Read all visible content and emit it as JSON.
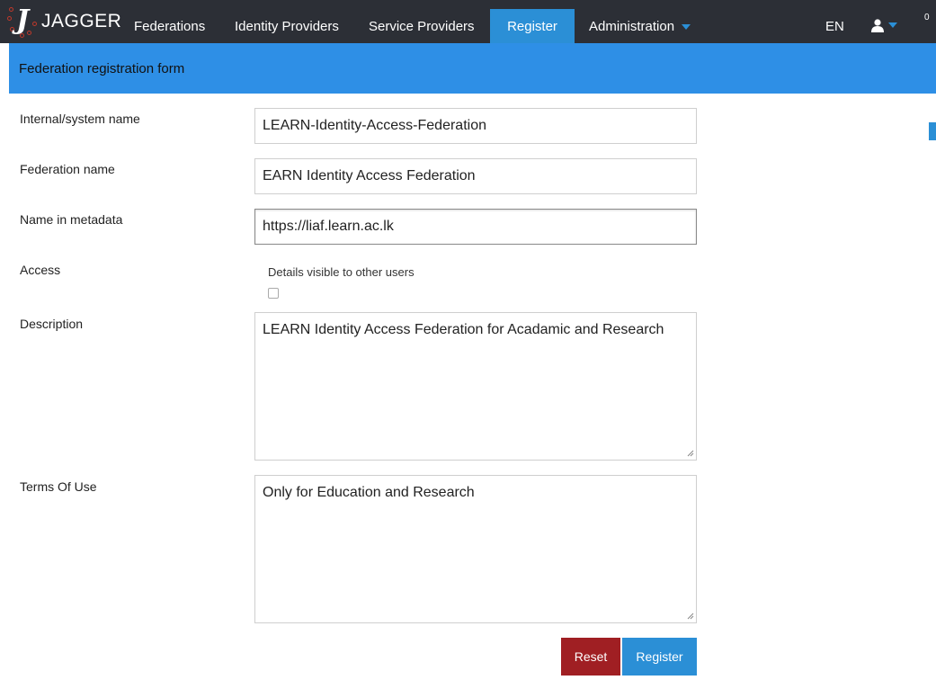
{
  "app": {
    "name": "JAGGER"
  },
  "nav": {
    "items": [
      {
        "label": "Federations",
        "active": false
      },
      {
        "label": "Identity Providers",
        "active": false
      },
      {
        "label": "Service Providers",
        "active": false
      },
      {
        "label": "Register",
        "active": true
      },
      {
        "label": "Administration",
        "active": false,
        "dropdown": true
      }
    ],
    "language": "EN",
    "user_icon": "user-icon",
    "count": "0"
  },
  "page": {
    "title": "Federation registration form"
  },
  "form": {
    "internal_name": {
      "label": "Internal/system name",
      "value": "LEARN-Identity-Access-Federation"
    },
    "federation_name": {
      "label": "Federation name",
      "value": "EARN Identity Access Federation"
    },
    "metadata_name": {
      "label": "Name in metadata",
      "value": "https://liaf.learn.ac.lk"
    },
    "access": {
      "label": "Access",
      "option_label": "Details visible to other users",
      "checked": false
    },
    "description": {
      "label": "Description",
      "value": "LEARN Identity Access Federation for Acadamic and Research"
    },
    "terms": {
      "label": "Terms Of Use",
      "value": "Only for Education and Research"
    },
    "reset_label": "Reset",
    "register_label": "Register"
  },
  "colors": {
    "navbar": "#2c2f36",
    "accent": "#2b8fd6",
    "title_bar": "#2e8fe6",
    "reset": "#a01f23"
  }
}
